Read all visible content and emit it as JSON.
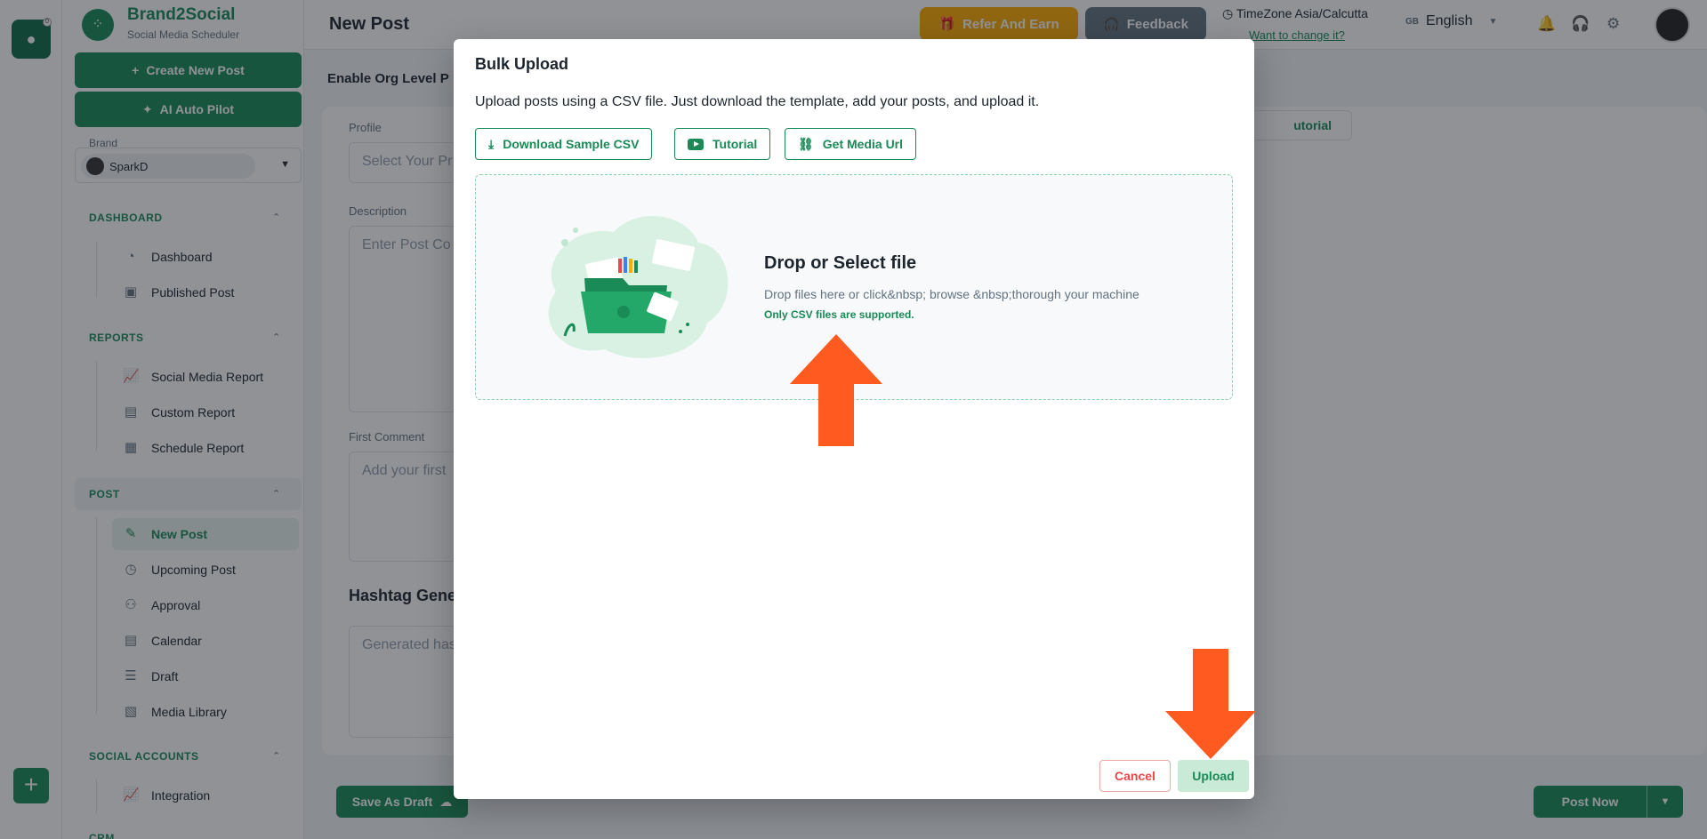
{
  "brand": {
    "name": "Brand2Social",
    "tagline": "Social Media Scheduler",
    "create_post": "Create New Post",
    "ai_pilot": "AI Auto Pilot",
    "brand_label": "Brand",
    "selected_brand": "SparkD"
  },
  "sidebar": {
    "sections": {
      "dashboard": "DASHBOARD",
      "reports": "REPORTS",
      "post": "POST",
      "social_accounts": "SOCIAL ACCOUNTS",
      "crm": "CRM"
    },
    "items": {
      "dashboard": "Dashboard",
      "published_post": "Published Post",
      "social_media_report": "Social Media Report",
      "custom_report": "Custom Report",
      "schedule_report": "Schedule Report",
      "new_post": "New Post",
      "upcoming_post": "Upcoming Post",
      "approval": "Approval",
      "calendar": "Calendar",
      "draft": "Draft",
      "media_library": "Media Library",
      "integration": "Integration"
    }
  },
  "header": {
    "title": "New Post",
    "refer": "Refer And Earn",
    "feedback": "Feedback",
    "timezone": "TimeZone Asia/Calcutta",
    "timezone_link": "Want to change it?",
    "language_code": "GB",
    "language": "English"
  },
  "form": {
    "org_level": "Enable Org Level P",
    "profile_label": "Profile",
    "profile_placeholder": "Select Your Pr",
    "description_label": "Description",
    "description_placeholder": "Enter Post Co",
    "first_comment_label": "First Comment",
    "first_comment_placeholder": "Add your first",
    "hashtag_title": "Hashtag Gene",
    "hashtag_placeholder": "Generated has",
    "tutorial": "utorial",
    "save_draft": "Save As Draft",
    "post_now": "Post Now"
  },
  "modal": {
    "title": "Bulk Upload",
    "description": "Upload posts using a CSV file. Just download the template, add your posts, and upload it.",
    "download_csv": "Download Sample CSV",
    "tutorial": "Tutorial",
    "media_url": "Get Media Url",
    "drop_title": "Drop or Select file",
    "drop_sub": "Drop files here or click&nbsp; browse &nbsp;thorough your machine",
    "drop_note": "Only CSV files are supported.",
    "cancel": "Cancel",
    "upload": "Upload"
  },
  "colors": {
    "primary": "#1a8a57",
    "annotation_arrow": "#ff5a1f",
    "danger": "#e5484d"
  }
}
